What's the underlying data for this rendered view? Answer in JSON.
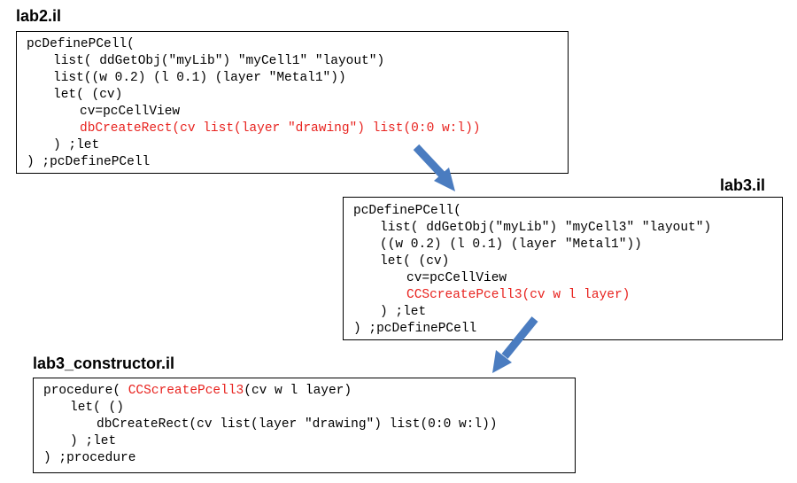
{
  "files": [
    {
      "title": "lab2.il",
      "lines": [
        {
          "text": "pcDefinePCell("
        },
        {
          "text": "list( ddGetObj(\"myLib\") \"myCell1\" \"layout\")"
        },
        {
          "text": "list((w 0.2) (l 0.1) (layer \"Metal1\"))"
        },
        {
          "text": "let( (cv)"
        },
        {
          "text": "cv=pcCellView"
        },
        {
          "text": "dbCreateRect(cv list(layer \"drawing\") list(0:0 w:l))",
          "highlight": true
        },
        {
          "text": ") ;let"
        },
        {
          "text": ") ;pcDefinePCell"
        }
      ]
    },
    {
      "title": "lab3.il",
      "lines": [
        {
          "text": "pcDefinePCell("
        },
        {
          "text": "list( ddGetObj(\"myLib\") \"myCell3\" \"layout\")"
        },
        {
          "text": "((w 0.2) (l 0.1) (layer \"Metal1\"))"
        },
        {
          "text": "let( (cv)"
        },
        {
          "text": "cv=pcCellView"
        },
        {
          "text": "CCScreatePcell3(cv w l layer)",
          "highlight": true
        },
        {
          "text": ") ;let"
        },
        {
          "text": ") ;pcDefinePCell"
        }
      ]
    },
    {
      "title": "lab3_constructor.il",
      "lines": [
        {
          "text": "procedure( ",
          "text_hl": "CCScreatePcell3",
          "text_rest": "(cv w l layer)"
        },
        {
          "text": "let( ()"
        },
        {
          "text": "dbCreateRect(cv list(layer \"drawing\") list(0:0 w:l))"
        },
        {
          "text": ") ;let"
        },
        {
          "text": ") ;procedure"
        }
      ]
    }
  ],
  "colors": {
    "highlight_text": "#e8231f",
    "arrow": "#4a7cc0",
    "border": "#000000"
  }
}
